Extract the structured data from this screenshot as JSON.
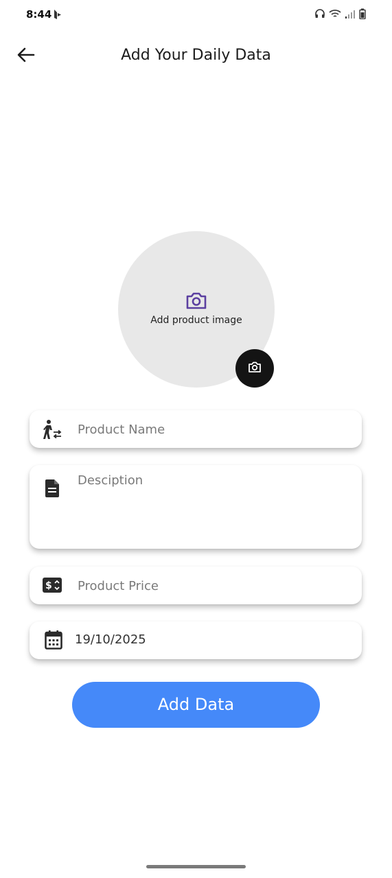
{
  "status_bar": {
    "time": "8:44"
  },
  "header": {
    "title": "Add Your Daily Data",
    "back_icon": "arrow-left-icon"
  },
  "image_picker": {
    "label": "Add product image",
    "icon": "camera-icon",
    "accent_color": "#5b3fa0"
  },
  "form": {
    "product_name": {
      "placeholder": "Product Name",
      "value": "",
      "icon": "person-trolley-icon"
    },
    "description": {
      "placeholder": "Desciption",
      "value": "",
      "icon": "document-icon"
    },
    "product_price": {
      "placeholder": "Product Price",
      "value": "",
      "icon": "price-tag-icon"
    },
    "date": {
      "value": "19/10/2025",
      "icon": "calendar-icon"
    }
  },
  "submit_button": {
    "label": "Add Data",
    "color": "#4589f9"
  }
}
